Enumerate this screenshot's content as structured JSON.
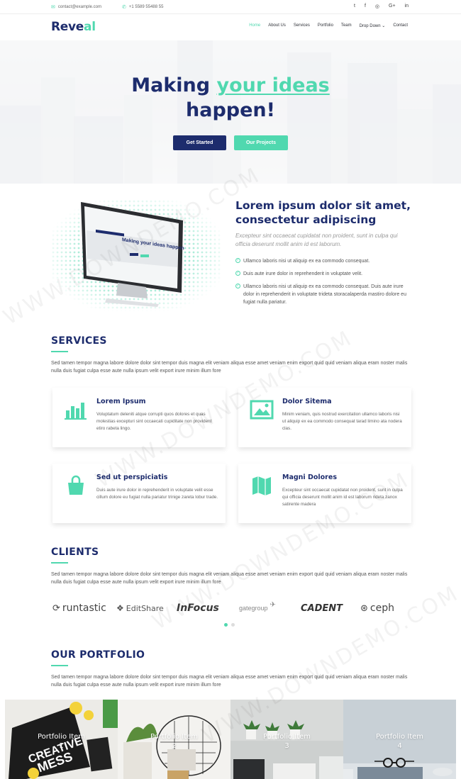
{
  "topbar": {
    "email": "contact@example.com",
    "phone": "+1 5589 55488 55",
    "social_icons": [
      "twitter-icon",
      "facebook-icon",
      "instagram-icon",
      "google-plus-icon",
      "linkedin-icon"
    ],
    "social_glyphs": [
      "t",
      "f",
      "◎",
      "G+",
      "in"
    ]
  },
  "header": {
    "logo_main": "Reve",
    "logo_accent": "al",
    "nav": [
      "Home",
      "About Us",
      "Services",
      "Portfolio",
      "Team",
      "Drop Down",
      "Contact"
    ],
    "active_nav": "Home"
  },
  "hero": {
    "title_line1_a": "Making ",
    "title_line1_accent": "your ideas",
    "title_line2": "happen!",
    "primary_button": "Get Started",
    "secondary_button": "Our Projects"
  },
  "about": {
    "mockup_title": "Making your ideas happen",
    "title": "Lorem ipsum dolor sit amet, consectetur adipiscing",
    "lead": "Excepteur sint occaecat cupidatat non proident, sunt in culpa qui officia deserunt mollit anim id est laborum.",
    "checks": [
      "Ullamco laboris nisi ut aliquip ex ea commodo consequat.",
      "Duis aute irure dolor in reprehenderit in voluptate velit.",
      "Ullamco laboris nisi ut aliquip ex ea commodo consequat. Duis aute irure dolor in reprehenderit in voluptate trideta storacalaperda mastiro dolore eu fugiat nulla pariatur."
    ]
  },
  "services": {
    "title": "SERVICES",
    "description": "Sed tamen tempor magna labore dolore dolor sint tempor duis magna elit veniam aliqua esse amet veniam enim export quid quid veniam aliqua eram noster malis nulla duis fugiat culpa esse aute nulla ipsum velit export irure minim illum fore",
    "cards": [
      {
        "title": "Lorem Ipsum",
        "text": "Voluptatum deleniti atque corrupti quos dolores et quas molestias excepturi sint occaecati cupiditate non provident etiro rabeta lingo.",
        "icon": "bar-chart-icon"
      },
      {
        "title": "Dolor Sitema",
        "text": "Minim veniam, quis nostrud exercitation ullamco laboris nisi ut aliquip ex ea commodo consequat tarad limino ata nodera clas.",
        "icon": "picture-icon"
      },
      {
        "title": "Sed ut perspiciatis",
        "text": "Duis aute irure dolor in reprehenderit in voluptate velit esse cillum dolore eu fugiat nulla pariatur trinige zareta lobur trade.",
        "icon": "shopping-bag-icon"
      },
      {
        "title": "Magni Dolores",
        "text": "Excepteur sint occaecat cupidatat non proident, sunt in culpa qui officia deserunt mollit anim id est laborum rideta zanox satirente madera",
        "icon": "map-icon"
      }
    ]
  },
  "clients": {
    "title": "CLIENTS",
    "description": "Sed tamen tempor magna labore dolore dolor sint tempor duis magna elit veniam aliqua esse amet veniam enim export quid quid veniam aliqua eram noster malis nulla duis fugiat culpa esse aute nulla ipsum velit export irure minim illum fore",
    "logos": [
      "runtastic",
      "EditShare",
      "InFocus",
      "gategroup",
      "CADENT",
      "ceph"
    ],
    "carousel_pages": 2,
    "active_page": 1
  },
  "portfolio": {
    "title": "OUR PORTFOLIO",
    "description": "Sed tamen tempor magna labore dolore dolor sint tempor duis magna elit veniam aliqua esse amet veniam enim export quid quid veniam aliqua eram noster malis nulla duis fugiat culpa esse aute nulla ipsum velit export irure minim illum fore",
    "items": [
      {
        "title": "Portfolio Item",
        "number": "1"
      },
      {
        "title": "Portfolio Item",
        "number": "2"
      },
      {
        "title": "Portfolio Item",
        "number": "3"
      },
      {
        "title": "Portfolio Item",
        "number": "4"
      }
    ]
  },
  "watermark": "WWW.DOWNDEMO.COM",
  "colors": {
    "primary": "#1d2c6d",
    "accent": "#50d8af"
  }
}
